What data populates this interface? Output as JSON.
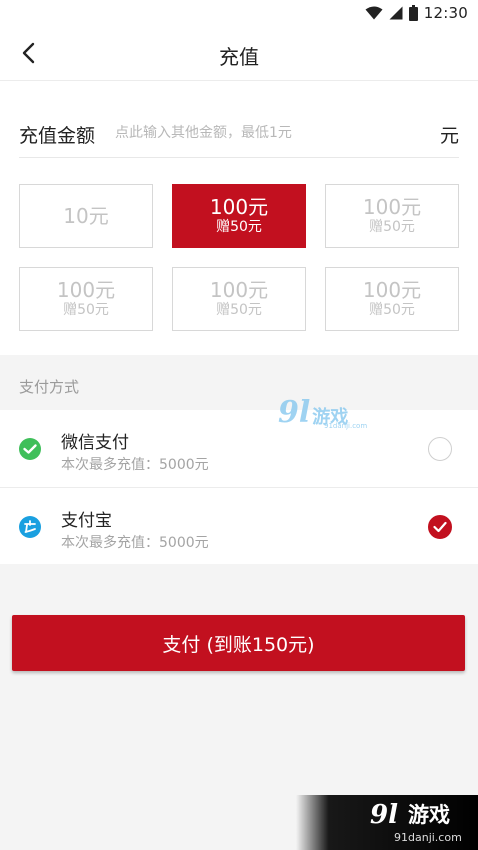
{
  "status_bar": {
    "time": "12:30",
    "icons": [
      "wifi-icon",
      "signal-icon",
      "battery-icon"
    ]
  },
  "nav": {
    "title": "充值",
    "back_icon": "chevron-left-icon"
  },
  "amount": {
    "label": "充值金额",
    "placeholder": "点此输入其他金额，最低1元",
    "value": "",
    "unit": "元"
  },
  "options": [
    {
      "main": "10元",
      "sub": "",
      "selected": false
    },
    {
      "main": "100元",
      "sub": "赠50元",
      "selected": true
    },
    {
      "main": "100元",
      "sub": "赠50元",
      "selected": false
    },
    {
      "main": "100元",
      "sub": "赠50元",
      "selected": false
    },
    {
      "main": "100元",
      "sub": "赠50元",
      "selected": false
    },
    {
      "main": "100元",
      "sub": "赠50元",
      "selected": false
    }
  ],
  "payment": {
    "header": "支付方式",
    "methods": [
      {
        "name": "微信支付",
        "limit": "本次最多充值：5000元",
        "icon": "wechat-pay-icon",
        "checked": false
      },
      {
        "name": "支付宝",
        "limit": "本次最多充值：5000元",
        "icon": "alipay-icon",
        "checked": true
      }
    ]
  },
  "pay_button": {
    "label": "支付 (到账150元)"
  },
  "watermark": {
    "number": "9l",
    "text": "游戏",
    "url": "91danji.com"
  },
  "corner_logo": {
    "number": "9l",
    "text": "游戏",
    "url": "91danji.com"
  },
  "colors": {
    "accent": "#c2101f",
    "wechat": "#3fbf5a",
    "alipay": "#1aa0e0",
    "watermark": "#7fc5ee"
  }
}
